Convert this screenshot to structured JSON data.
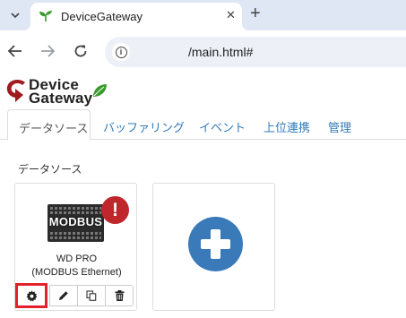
{
  "browser": {
    "tab_title": "DeviceGateway",
    "tab_close": "✕",
    "new_tab": "+",
    "url": "/main.html#"
  },
  "logo": {
    "line1": "Device",
    "line2": "Gateway"
  },
  "nav": {
    "tabs": [
      {
        "label": "データソース",
        "active": true
      },
      {
        "label": "バッファリング"
      },
      {
        "label": "イベント"
      },
      {
        "label": "上位連携"
      },
      {
        "label": "管理"
      }
    ]
  },
  "section": {
    "title": "データソース"
  },
  "devices": [
    {
      "image_label": "MODBUS",
      "name": "WD PRO",
      "protocol": "(MODBUS Ethernet)",
      "alert": "!",
      "buttons": [
        "gear-icon",
        "pencil-icon",
        "copy-icon",
        "trash-icon"
      ]
    }
  ],
  "colors": {
    "accent": "#337ab7",
    "add_button": "#3a7ab9",
    "alert": "#c0272d",
    "highlight": "#e1222a",
    "logo_leaf": "#3a9a2e",
    "logo_arrow": "#9e1b1f"
  }
}
